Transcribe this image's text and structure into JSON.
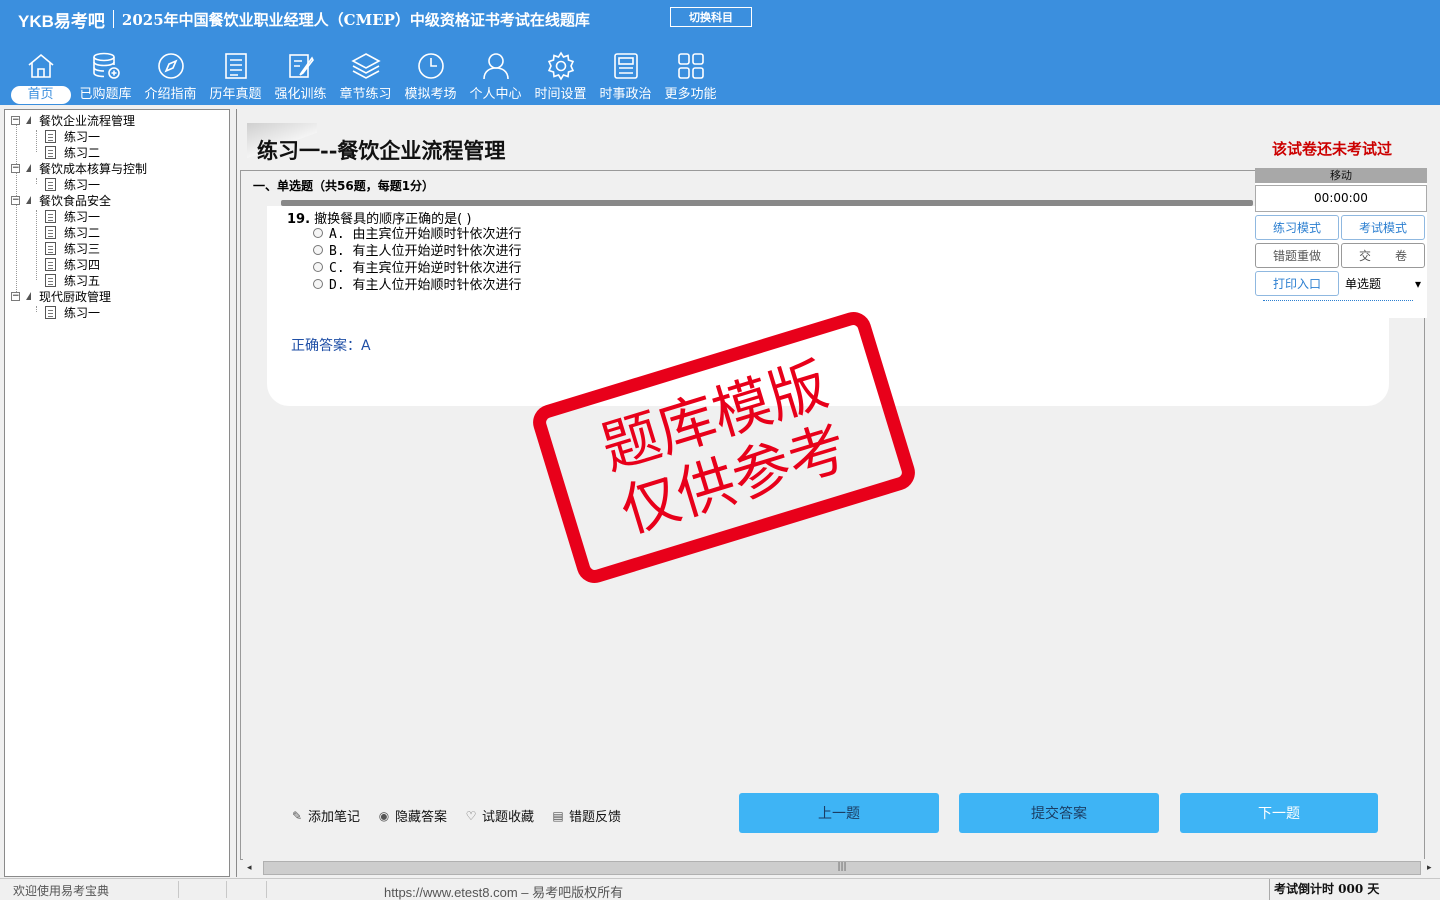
{
  "header": {
    "logo": "YKB易考吧",
    "title": "2025年中国餐饮业职业经理人（CMEP）中级资格证书考试在线题库",
    "switch_label": "切换科目"
  },
  "nav": [
    {
      "label": "首页",
      "icon": "home-icon"
    },
    {
      "label": "已购题库",
      "icon": "database-icon"
    },
    {
      "label": "介绍指南",
      "icon": "compass-icon"
    },
    {
      "label": "历年真题",
      "icon": "list-icon"
    },
    {
      "label": "强化训练",
      "icon": "edit-icon"
    },
    {
      "label": "章节练习",
      "icon": "layers-icon"
    },
    {
      "label": "模拟考场",
      "icon": "clock-icon"
    },
    {
      "label": "个人中心",
      "icon": "user-icon"
    },
    {
      "label": "时间设置",
      "icon": "gear-icon"
    },
    {
      "label": "时事政治",
      "icon": "news-icon"
    },
    {
      "label": "更多功能",
      "icon": "grid-icon"
    }
  ],
  "tree": {
    "chapters": [
      {
        "label": "餐饮企业流程管理",
        "items": [
          "练习一",
          "练习二"
        ]
      },
      {
        "label": "餐饮成本核算与控制",
        "items": [
          "练习一"
        ]
      },
      {
        "label": "餐饮食品安全",
        "items": [
          "练习一",
          "练习二",
          "练习三",
          "练习四",
          "练习五"
        ]
      },
      {
        "label": "现代厨政管理",
        "items": [
          "练习一"
        ]
      }
    ]
  },
  "main": {
    "page_title": "练习一--餐饮企业流程管理",
    "status_note": "该试卷还未考试过",
    "section_head": "一、单选题（共56题，每题1分）",
    "question": {
      "number": "19.",
      "text": "撤换餐具的顺序正确的是( )",
      "options": [
        "A. 由主宾位开始顺时针依次进行",
        "B. 有主人位开始逆时针依次进行",
        "C. 有主宾位开始逆时针依次进行",
        "D. 有主人位开始顺时针依次进行"
      ],
      "answer_label": "正确答案：",
      "answer_value": "A"
    },
    "stamp": {
      "line1": "题库模版",
      "line2": "仅供参考"
    },
    "tools": [
      "添加笔记",
      "隐藏答案",
      "试题收藏",
      "错题反馈"
    ],
    "buttons": {
      "prev": "上一题",
      "submit": "提交答案",
      "next": "下一题"
    }
  },
  "side_panel": {
    "move_label": "移动",
    "timer": "00:00:00",
    "practice_mode": "练习模式",
    "exam_mode": "考试模式",
    "redo_wrong": "错题重做",
    "hand_in": "交　　卷",
    "print": "打印入口",
    "type_select": "单选题"
  },
  "status_bar": {
    "welcome": "欢迎使用易考宝典",
    "copyright": "https://www.etest8.com – 易考吧版权所有",
    "countdown": "考试倒计时 000 天"
  },
  "colors": {
    "header": "#3b8fde",
    "stamp": "#e8001a",
    "button": "#3eb4f5",
    "not_tested": "#cc0000"
  }
}
